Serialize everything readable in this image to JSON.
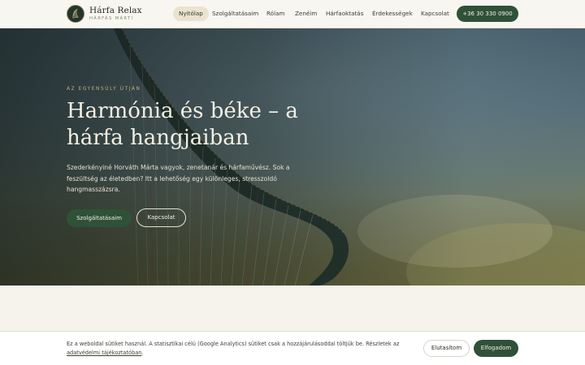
{
  "brand": {
    "title": "Hárfa Relax",
    "subtitle": "HÁRFÁS MÁRTI"
  },
  "nav": {
    "items": [
      {
        "label": "Nyitólap",
        "active": true
      },
      {
        "label": "Szolgáltatásaim",
        "active": false
      },
      {
        "label": "Rólam",
        "active": false
      },
      {
        "label": "Zenéim",
        "active": false
      },
      {
        "label": "Hárfaoktatás",
        "active": false
      },
      {
        "label": "Érdekességek",
        "active": false
      },
      {
        "label": "Kapcsolat",
        "active": false
      }
    ],
    "phone": "+36 30 330 0900"
  },
  "hero": {
    "eyebrow": "AZ EGYENSÚLY ÚTJÁN",
    "title": "Harmónia és béke – a hárfa hangjaiban",
    "text": "Szederkényiné Horváth Márta vagyok, zenetanár és hárfaművész. Sok a feszültség az életedben? Itt a lehetőség egy különleges, stresszoldó hangmasszázsra.",
    "primary_button": "Szolgáltatásaim",
    "secondary_button": "Kapcsolat"
  },
  "cookie": {
    "text": "Ez a weboldal sütiket használ. A statisztikai célú (Google Analytics) sütiket csak a hozzájárulásoddal töltjük be. Részletek az",
    "link": "adatvédelmi tájékoztatóban",
    "text_end": ".",
    "reject_button": "Elutasítom",
    "accept_button": "Elfogadom"
  },
  "colors": {
    "accent": "#2f5138",
    "header_bg": "#f8f6f0",
    "active_nav_bg": "#ebe3cf",
    "eyebrow": "#c7b17c"
  },
  "icons": {
    "logo": "harp-logo-icon"
  }
}
